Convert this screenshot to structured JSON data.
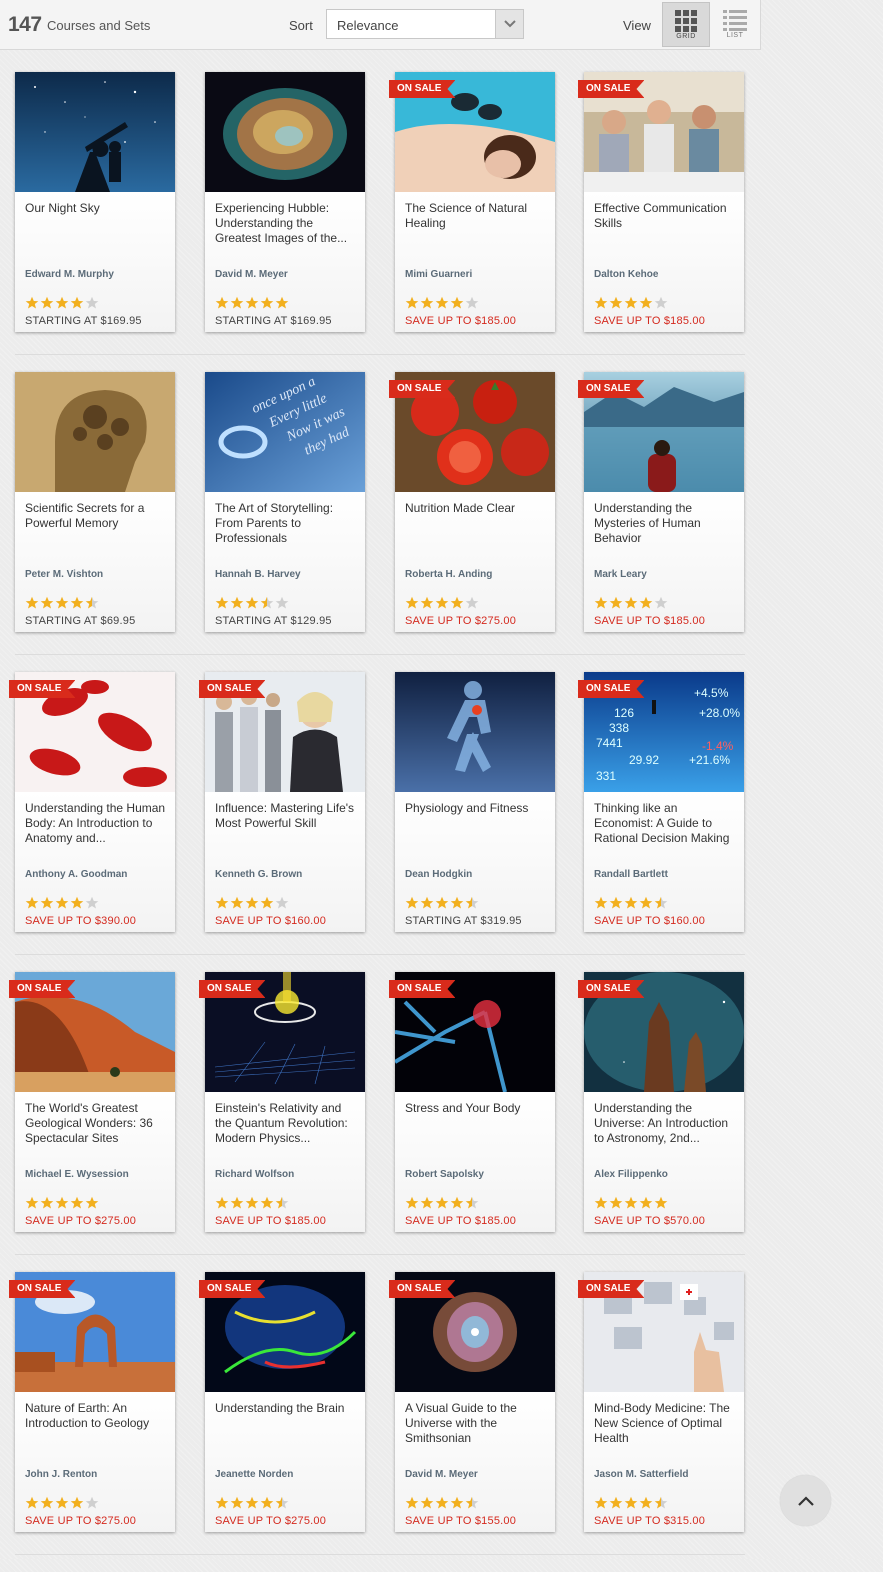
{
  "toolbar": {
    "count": "147",
    "count_label": "Courses and Sets",
    "sort_label": "Sort",
    "sort_value": "Relevance",
    "view_label": "View",
    "grid_label": "GRID",
    "list_label": "LIST"
  },
  "badge_text": "ON SALE",
  "colors": {
    "sale_red": "#d92b1b",
    "star_gold": "#f2b01e",
    "star_empty": "#cfcfcf"
  },
  "rows": [
    {
      "cards": [
        {
          "title": "Our Night Sky",
          "author": "Edward M. Murphy",
          "rating": 4,
          "price": "STARTING AT $169.95",
          "on_sale": false,
          "image": "telescope-night-sky"
        },
        {
          "title": "Experiencing Hubble: Understanding the Greatest Images of the...",
          "author": "David M. Meyer",
          "rating": 5,
          "price": "STARTING AT $169.95",
          "on_sale": false,
          "image": "crab-nebula"
        },
        {
          "title": "The Science of Natural Healing",
          "author": "Mimi Guarneri",
          "rating": 4,
          "price": "SAVE UP TO $185.00",
          "on_sale": true,
          "image": "hot-stone-massage"
        },
        {
          "title": "Effective Communication Skills",
          "author": "Dalton Kehoe",
          "rating": 4,
          "price": "SAVE UP TO $185.00",
          "on_sale": true,
          "image": "friends-dinner"
        }
      ]
    },
    {
      "cards": [
        {
          "title": "Scientific Secrets for a Powerful Memory",
          "author": "Peter M. Vishton",
          "rating": 4.5,
          "price": "STARTING AT $69.95",
          "on_sale": false,
          "image": "gear-head"
        },
        {
          "title": "The Art of Storytelling: From Parents to Professionals",
          "author": "Hannah B. Harvey",
          "rating": 3.5,
          "price": "STARTING AT $129.95",
          "on_sale": false,
          "image": "story-text"
        },
        {
          "title": "Nutrition Made Clear",
          "author": "Roberta H. Anding",
          "rating": 4,
          "price": "SAVE UP TO $275.00",
          "on_sale": true,
          "image": "tomatoes"
        },
        {
          "title": "Understanding the Mysteries of Human Behavior",
          "author": "Mark Leary",
          "rating": 4,
          "price": "SAVE UP TO $185.00",
          "on_sale": true,
          "image": "man-by-lake"
        }
      ]
    },
    {
      "cards": [
        {
          "title": "Understanding the Human Body: An Introduction to Anatomy and...",
          "author": "Anthony A. Goodman",
          "rating": 4,
          "price": "SAVE UP TO $390.00",
          "on_sale": true,
          "image": "blood-cells"
        },
        {
          "title": "Influence: Mastering Life's Most Powerful Skill",
          "author": "Kenneth G. Brown",
          "rating": 4,
          "price": "SAVE UP TO $160.00",
          "on_sale": true,
          "image": "businesswoman"
        },
        {
          "title": "Physiology and Fitness",
          "author": "Dean Hodgkin",
          "rating": 4.5,
          "price": "STARTING AT $319.95",
          "on_sale": false,
          "image": "runner-anatomy"
        },
        {
          "title": "Thinking like an Economist: A Guide to Rational Decision Making",
          "author": "Randall Bartlett",
          "rating": 4.5,
          "price": "SAVE UP TO $160.00",
          "on_sale": true,
          "image": "stock-numbers"
        }
      ]
    },
    {
      "cards": [
        {
          "title": "The World's Greatest Geological Wonders: 36 Spectacular Sites",
          "author": "Michael E. Wysession",
          "rating": 5,
          "price": "SAVE UP TO $275.00",
          "on_sale": true,
          "image": "sand-dune"
        },
        {
          "title": "Einstein's Relativity and the Quantum Revolution: Modern Physics...",
          "author": "Richard Wolfson",
          "rating": 4.5,
          "price": "SAVE UP TO $185.00",
          "on_sale": true,
          "image": "spacetime-grid"
        },
        {
          "title": "Stress and Your Body",
          "author": "Robert Sapolsky",
          "rating": 4.5,
          "price": "SAVE UP TO $185.00",
          "on_sale": true,
          "image": "xray-shoulder"
        },
        {
          "title": "Understanding the Universe: An Introduction to Astronomy, 2nd...",
          "author": "Alex Filippenko",
          "rating": 5,
          "price": "SAVE UP TO $570.00",
          "on_sale": true,
          "image": "pillars-nebula"
        }
      ]
    },
    {
      "cards": [
        {
          "title": "Nature of Earth: An Introduction to Geology",
          "author": "John J. Renton",
          "rating": 4,
          "price": "SAVE UP TO $275.00",
          "on_sale": true,
          "image": "rock-arch"
        },
        {
          "title": "Understanding the Brain",
          "author": "Jeanette Norden",
          "rating": 4.5,
          "price": "SAVE UP TO $275.00",
          "on_sale": true,
          "image": "brain-neurons"
        },
        {
          "title": "A Visual Guide to the Universe with the Smithsonian",
          "author": "David M. Meyer",
          "rating": 4.5,
          "price": "SAVE UP TO $155.00",
          "on_sale": true,
          "image": "cats-eye-nebula"
        },
        {
          "title": "Mind-Body Medicine: The New Science of Optimal Health",
          "author": "Jason M. Satterfield",
          "rating": 4.5,
          "price": "SAVE UP TO $315.00",
          "on_sale": true,
          "image": "touch-screen"
        }
      ]
    }
  ]
}
